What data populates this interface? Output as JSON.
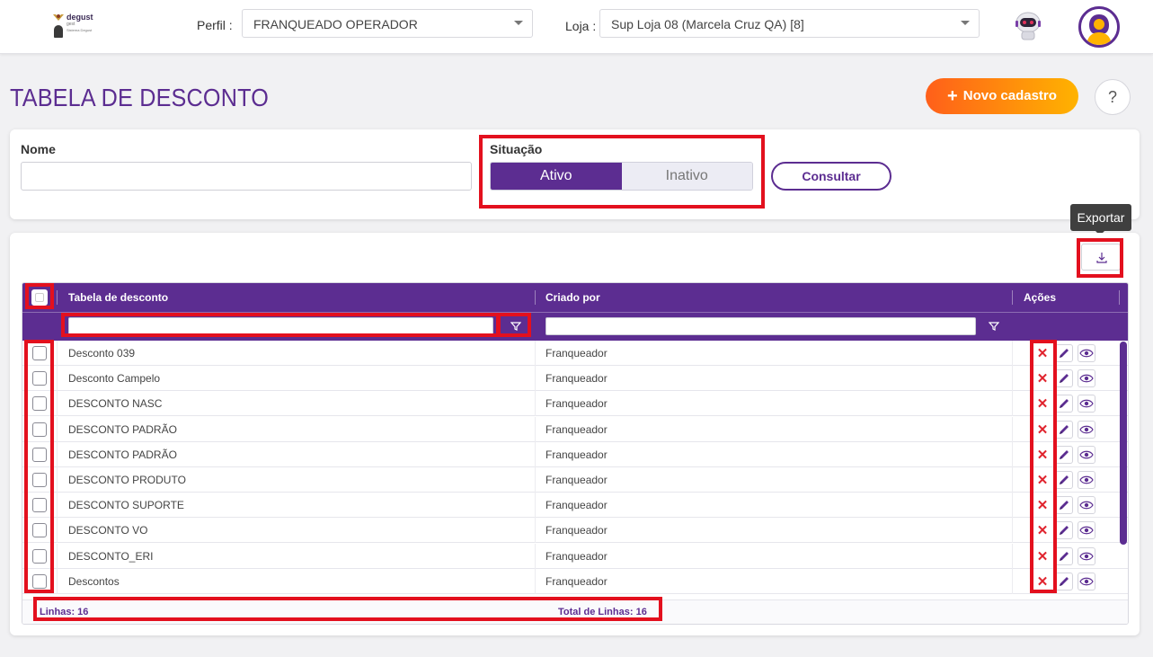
{
  "header": {
    "logo": {
      "brand": "degust",
      "sub1": "gest",
      "sub2": "Sistema Degust"
    },
    "perfil_label": "Perfil :",
    "perfil_value": "FRANQUEADO OPERADOR",
    "loja_label": "Loja :",
    "loja_value": "Sup Loja 08 (Marcela Cruz QA) [8]"
  },
  "page": {
    "title": "TABELA DE DESCONTO",
    "new_button": "Novo cadastro",
    "help_button": "?"
  },
  "filters": {
    "nome_label": "Nome",
    "nome_value": "",
    "situacao_label": "Situação",
    "situacao_options": [
      "Ativo",
      "Inativo"
    ],
    "situacao_selected": "Ativo",
    "consultar_label": "Consultar"
  },
  "export": {
    "tooltip": "Exportar"
  },
  "grid": {
    "columns": [
      "Tabela de desconto",
      "Criado por",
      "Ações"
    ],
    "rows": [
      {
        "name": "Desconto 039",
        "criado_por": "Franqueador"
      },
      {
        "name": "Desconto Campelo",
        "criado_por": "Franqueador"
      },
      {
        "name": "DESCONTO NASC",
        "criado_por": "Franqueador"
      },
      {
        "name": "DESCONTO PADRÃO",
        "criado_por": "Franqueador"
      },
      {
        "name": "DESCONTO PADRÃO",
        "criado_por": "Franqueador"
      },
      {
        "name": "DESCONTO PRODUTO",
        "criado_por": "Franqueador"
      },
      {
        "name": "DESCONTO SUPORTE",
        "criado_por": "Franqueador"
      },
      {
        "name": "DESCONTO VO",
        "criado_por": "Franqueador"
      },
      {
        "name": "DESCONTO_ERI",
        "criado_por": "Franqueador"
      },
      {
        "name": "Descontos",
        "criado_por": "Franqueador"
      }
    ],
    "footer_linhas": "Linhas: 16",
    "footer_total": "Total de Linhas: 16"
  },
  "colors": {
    "primary": "#5c2d91",
    "accent_start": "#ff5f1a",
    "accent_end": "#ffb300",
    "delete": "#e0242e",
    "highlight": "#e3101e"
  },
  "icons": [
    "logo-mark",
    "chevron-down-icon",
    "robot-icon",
    "user-avatar-icon",
    "plus-icon",
    "help-icon",
    "download-icon",
    "filter-icon",
    "delete-icon",
    "edit-icon",
    "view-icon"
  ]
}
